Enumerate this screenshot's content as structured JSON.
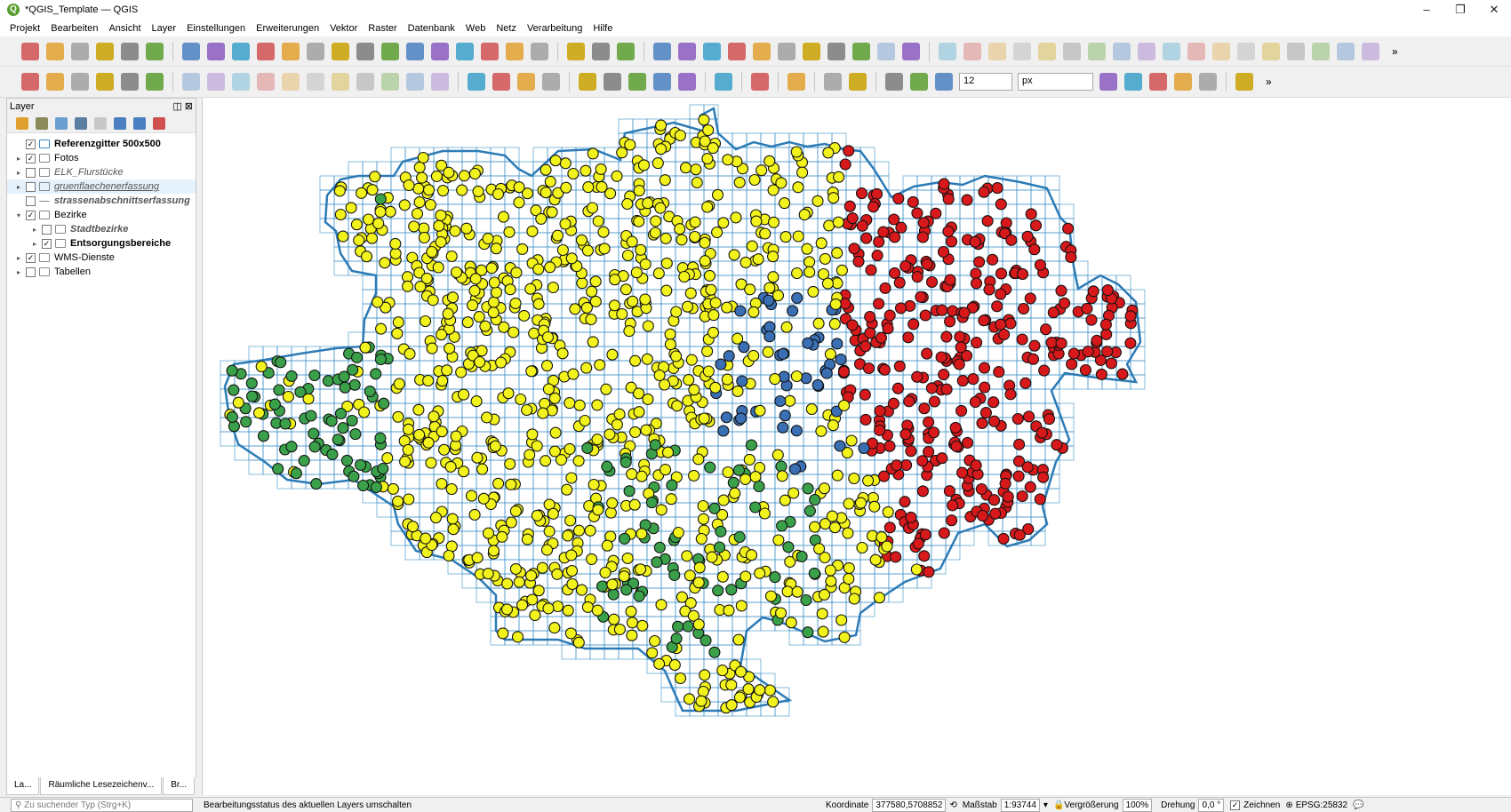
{
  "window": {
    "title": "*QGIS_Template — QGIS",
    "logo_letter": "Q",
    "minimize": "–",
    "maximize": "❐",
    "close": "✕"
  },
  "menu": [
    "Projekt",
    "Bearbeiten",
    "Ansicht",
    "Layer",
    "Einstellungen",
    "Erweiterungen",
    "Vektor",
    "Raster",
    "Datenbank",
    "Web",
    "Netz",
    "Verarbeitung",
    "Hilfe"
  ],
  "toolbar": {
    "snap_tolerance": "12",
    "snap_unit": "px",
    "overflow": "»"
  },
  "layer_panel": {
    "title": "Layer",
    "layers": [
      {
        "name": "Referenzgitter 500x500",
        "checked": "✓",
        "expand": ""
      },
      {
        "name": "Fotos",
        "checked": "✓",
        "expand": "▸"
      },
      {
        "name": "ELK_Flurstücke",
        "checked": "",
        "expand": "▸"
      },
      {
        "name": "gruenflaechenerfassung",
        "checked": "",
        "expand": "▸"
      },
      {
        "name": "strassenabschnittserfassung",
        "checked": "",
        "expand": ""
      },
      {
        "name": "Bezirke",
        "checked": "✓",
        "expand": "▾"
      },
      {
        "name": "Stadtbezirke",
        "checked": "",
        "expand": "▸"
      },
      {
        "name": "Entsorgungsbereiche",
        "checked": "✓",
        "expand": "▸"
      },
      {
        "name": "WMS-Dienste",
        "checked": "✓",
        "expand": "▸"
      },
      {
        "name": "Tabellen",
        "checked": "",
        "expand": "▸"
      }
    ],
    "tabs": [
      "La...",
      "Räumliche Lesezeichenv...",
      "Br..."
    ]
  },
  "statusbar": {
    "search_placeholder": "Zu suchender Typ (Strg+K)",
    "message": "Bearbeitungsstatus des aktuellen Layers umschalten",
    "coord_label": "Koordinate",
    "coord_value": "377580,5708852",
    "scale_label": "Maßstab",
    "scale_value": "1:93744",
    "magnifier_label": "Vergrößerung",
    "magnifier_value": "100%",
    "rotation_label": "Drehung",
    "rotation_value": "0,0 °",
    "render_label": "Zeichnen",
    "render_check": "✓",
    "crs": "EPSG:25832"
  },
  "map": {
    "colors": {
      "grid": "#3a8fc8",
      "boundary": "#2c7bb6",
      "yellow": "#f2f21c",
      "red": "#d7191c",
      "blue": "#3a6fb4",
      "green": "#3aa04a"
    }
  }
}
